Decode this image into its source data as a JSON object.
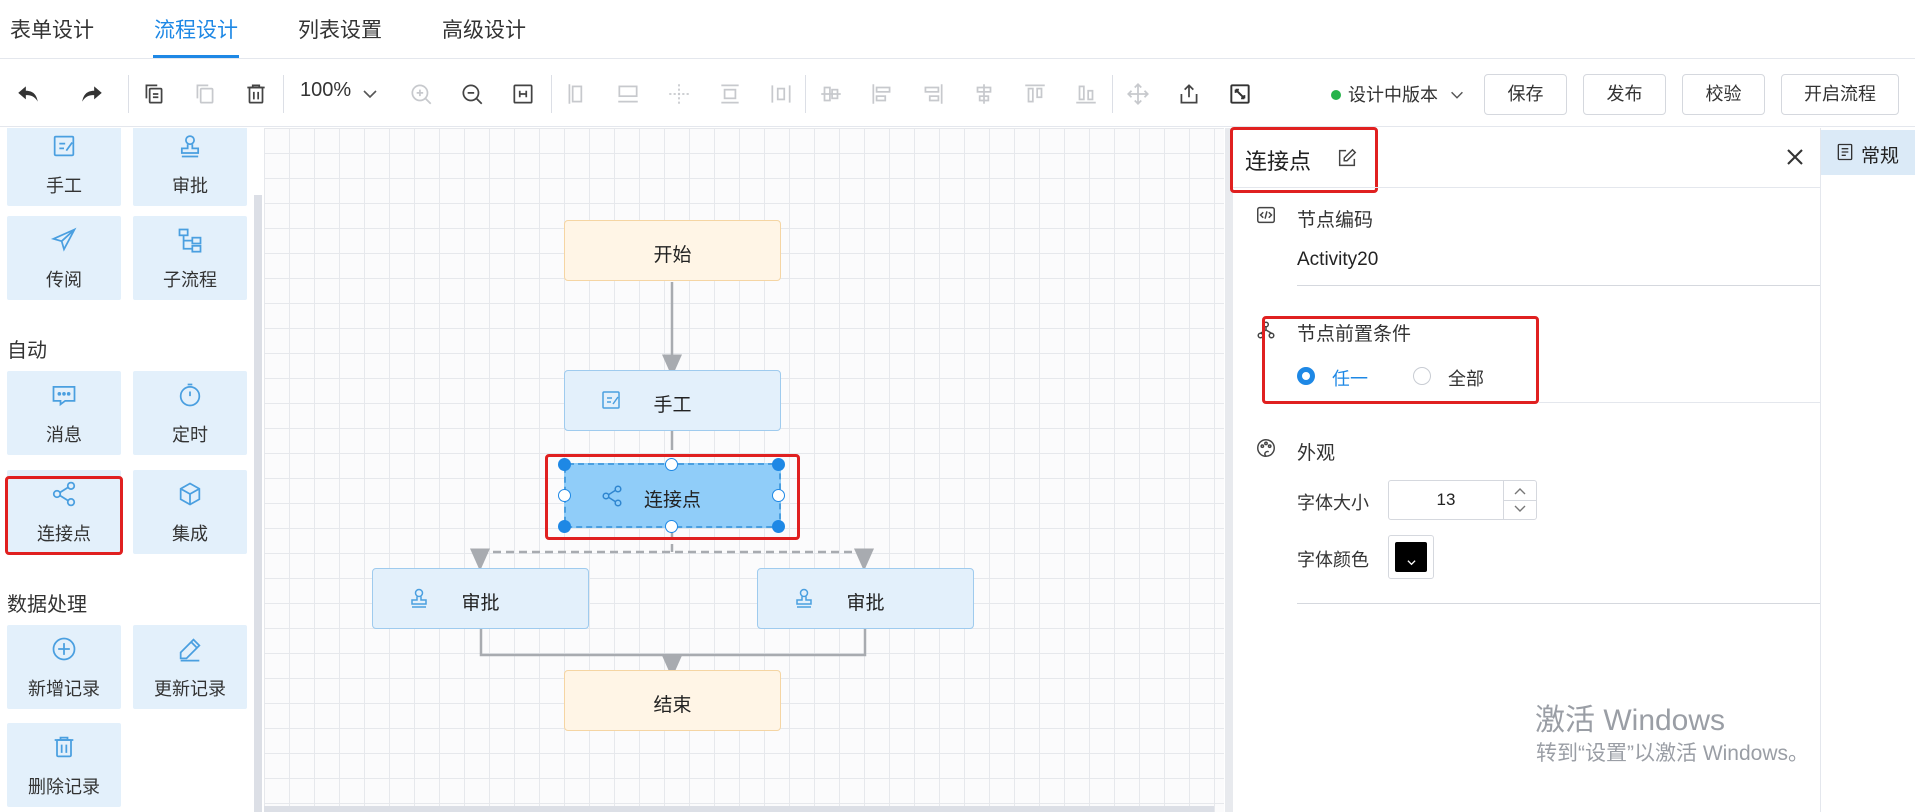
{
  "tabs": [
    {
      "label": "表单设计"
    },
    {
      "label": "流程设计"
    },
    {
      "label": "列表设置"
    },
    {
      "label": "高级设计"
    }
  ],
  "toolbar": {
    "zoom": "100%",
    "version": "设计中版本",
    "buttons": {
      "save": "保存",
      "publish": "发布",
      "validate": "校验",
      "start": "开启流程"
    }
  },
  "palette": {
    "groups": {
      "auto": "自动",
      "data": "数据处理"
    },
    "items": {
      "manual": "手工",
      "approve": "审批",
      "circulate": "传阅",
      "subprocess": "子流程",
      "message": "消息",
      "timer": "定时",
      "connector": "连接点",
      "integration": "集成",
      "add_record": "新增记录",
      "update_record": "更新记录",
      "delete_record": "删除记录"
    }
  },
  "flow": {
    "start": "开始",
    "manual": "手工",
    "connector": "连接点",
    "approve_left": "审批",
    "approve_right": "审批",
    "end": "结束"
  },
  "panel": {
    "title": "连接点",
    "node_code": {
      "label": "节点编码",
      "value": "Activity20"
    },
    "precondition": {
      "label": "节点前置条件",
      "options": [
        "任一",
        "全部"
      ],
      "selected": "任一"
    },
    "appearance": {
      "label": "外观",
      "font_size_label": "字体大小",
      "font_size": "13",
      "font_color_label": "字体颜色",
      "font_color": "#000000"
    }
  },
  "side_tab": {
    "label": "常规"
  },
  "watermark": {
    "line1": "激活 Windows",
    "line2": "转到“设置”以激活 Windows。"
  },
  "colors": {
    "accent": "#1e88e5",
    "highlight": "#e02020",
    "node_task": "#e3f0fb",
    "node_start": "#fff5e6",
    "selected_node": "#90cdf9"
  }
}
